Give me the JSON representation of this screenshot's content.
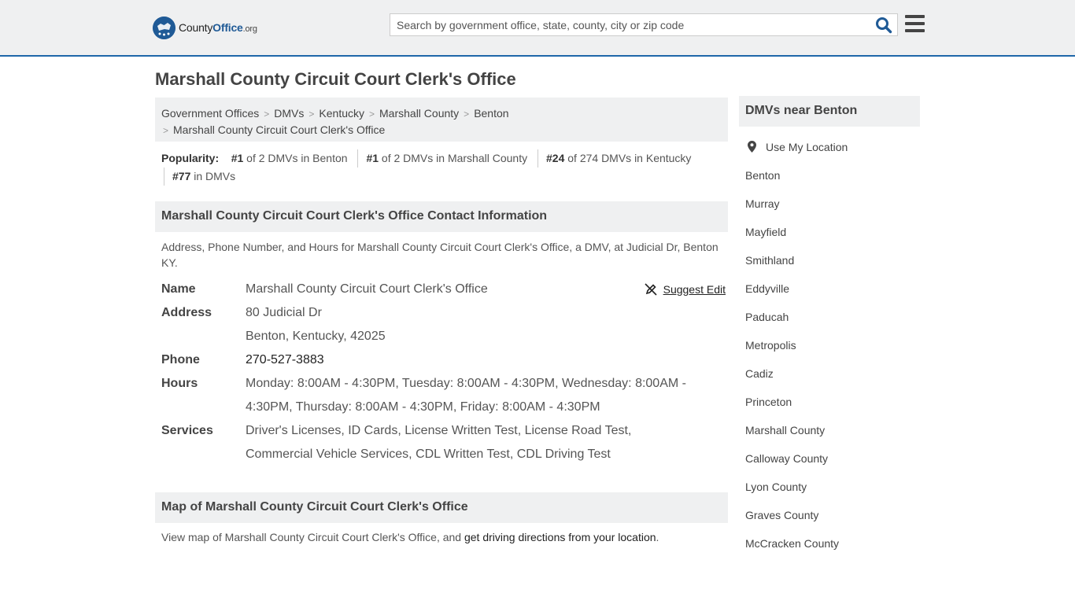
{
  "header": {
    "logo": {
      "name_part1": "County",
      "name_part2": "Office",
      "tld": ".org"
    },
    "search": {
      "placeholder": "Search by government office, state, county, city or zip code",
      "value": ""
    }
  },
  "page": {
    "title": "Marshall County Circuit Court Clerk's Office"
  },
  "breadcrumb": {
    "items": [
      "Government Offices",
      "DMVs",
      "Kentucky",
      "Marshall County",
      "Benton"
    ],
    "current": "Marshall County Circuit Court Clerk's Office"
  },
  "popularity": {
    "label": "Popularity:",
    "items": [
      {
        "rank": "#1",
        "text": "of 2 DMVs in Benton"
      },
      {
        "rank": "#1",
        "text": "of 2 DMVs in Marshall County"
      },
      {
        "rank": "#24",
        "text": "of 274 DMVs in Kentucky"
      },
      {
        "rank": "#77",
        "text": "in DMVs"
      }
    ]
  },
  "contact": {
    "heading": "Marshall County Circuit Court Clerk's Office Contact Information",
    "description": "Address, Phone Number, and Hours for Marshall County Circuit Court Clerk's Office, a DMV, at Judicial Dr, Benton KY.",
    "suggest_edit": "Suggest Edit",
    "name_label": "Name",
    "name": "Marshall County Circuit Court Clerk's Office",
    "address_label": "Address",
    "address_line1": "80 Judicial Dr",
    "address_line2": "Benton, Kentucky, 42025",
    "phone_label": "Phone",
    "phone": "270-527-3883",
    "hours_label": "Hours",
    "hours": "Monday: 8:00AM - 4:30PM, Tuesday: 8:00AM - 4:30PM, Wednesday: 8:00AM - 4:30PM, Thursday: 8:00AM - 4:30PM, Friday: 8:00AM - 4:30PM",
    "services_label": "Services",
    "services": "Driver's Licenses, ID Cards, License Written Test, License Road Test, Commercial Vehicle Services, CDL Written Test, CDL Driving Test"
  },
  "map": {
    "heading": "Map of Marshall County Circuit Court Clerk's Office",
    "text_prefix": "View map of Marshall County Circuit Court Clerk's Office, and ",
    "link": "get driving directions from your location",
    "text_suffix": "."
  },
  "sidebar": {
    "title": "DMVs near Benton",
    "use_location": "Use My Location",
    "links": [
      "Benton",
      "Murray",
      "Mayfield",
      "Smithland",
      "Eddyville",
      "Paducah",
      "Metropolis",
      "Cadiz",
      "Princeton",
      "Marshall County",
      "Calloway County",
      "Lyon County",
      "Graves County",
      "McCracken County"
    ]
  },
  "colors": {
    "accent": "#1e67a9",
    "panel_bg": "#eff0f1",
    "logo_blue": "#1f5a96"
  },
  "icons": [
    "flag-stars-logo-icon",
    "search-icon",
    "hamburger-menu-icon",
    "pencil-edit-icon",
    "location-pin-icon"
  ]
}
